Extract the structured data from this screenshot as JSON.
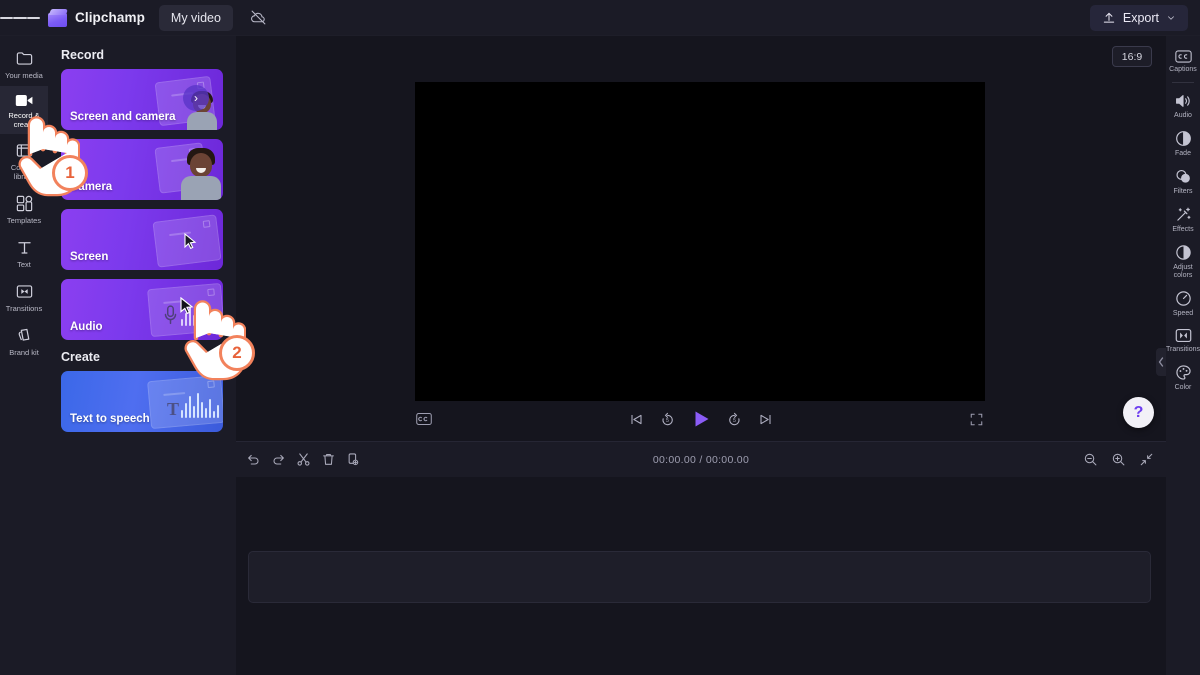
{
  "header": {
    "menu_icon": "hamburger-menu-icon",
    "brand": "Clipchamp",
    "project_name": "My video",
    "cloud_icon": "cloud-offline-icon",
    "export_label": "Export",
    "export_icon": "upload-icon",
    "export_caret": "chevron-down-icon"
  },
  "left_rail": {
    "items": [
      {
        "label": "Your media",
        "icon": "folder-icon",
        "active": false
      },
      {
        "label": "Record & create",
        "icon": "video-camera-icon",
        "active": true
      },
      {
        "label": "Content library",
        "icon": "library-icon",
        "active": false
      },
      {
        "label": "Templates",
        "icon": "templates-grid-icon",
        "active": false
      },
      {
        "label": "Text",
        "icon": "text-t-icon",
        "active": false
      },
      {
        "label": "Transitions",
        "icon": "transitions-icon",
        "active": false
      },
      {
        "label": "Brand kit",
        "icon": "brand-kit-icon",
        "active": false
      }
    ]
  },
  "panel": {
    "section_record": "Record",
    "section_create": "Create",
    "record_cards": [
      {
        "label": "Screen and camera",
        "art": "screen-and-camera-art",
        "color": "#7c3aed",
        "has_chevron": true
      },
      {
        "label": "Camera",
        "art": "camera-art",
        "color": "#7c3aed",
        "has_chevron": false
      },
      {
        "label": "Screen",
        "art": "screen-art",
        "color": "#7c3aed",
        "has_chevron": false
      },
      {
        "label": "Audio",
        "art": "audio-art",
        "color": "#7c3aed",
        "has_chevron": false
      }
    ],
    "create_cards": [
      {
        "label": "Text to speech",
        "art": "text-to-speech-art",
        "color": "#3b5bdb",
        "has_chevron": false
      }
    ]
  },
  "stage": {
    "aspect_ratio": "16:9",
    "player": {
      "captions_icon": "captions-toggle-icon",
      "skip_start_icon": "skip-to-start-icon",
      "back5_icon": "rewind-5s-icon",
      "play_icon": "play-icon",
      "fwd5_icon": "forward-5s-icon",
      "skip_end_icon": "skip-to-end-icon",
      "fullscreen_icon": "fullscreen-icon"
    },
    "help_label": "?",
    "collapse_icon": "chevron-left-icon"
  },
  "right_rail": {
    "items": [
      {
        "label": "Captions",
        "icon": "closed-captions-icon",
        "divider_after": true
      },
      {
        "label": "Audio",
        "icon": "speaker-icon",
        "divider_after": false
      },
      {
        "label": "Fade",
        "icon": "fade-icon",
        "divider_after": false
      },
      {
        "label": "Filters",
        "icon": "filters-icon",
        "divider_after": false
      },
      {
        "label": "Effects",
        "icon": "effects-wand-icon",
        "divider_after": false
      },
      {
        "label": "Adjust colors",
        "icon": "adjust-colors-icon",
        "divider_after": false
      },
      {
        "label": "Speed",
        "icon": "speed-gauge-icon",
        "divider_after": false
      },
      {
        "label": "Transitions",
        "icon": "transitions-icon",
        "divider_after": false
      },
      {
        "label": "Color",
        "icon": "color-palette-icon",
        "divider_after": false
      }
    ]
  },
  "timeline": {
    "tools": [
      {
        "name": "undo-button",
        "icon": "undo-icon"
      },
      {
        "name": "redo-button",
        "icon": "redo-icon"
      },
      {
        "name": "split-button",
        "icon": "scissors-icon"
      },
      {
        "name": "delete-button",
        "icon": "trash-icon"
      },
      {
        "name": "duplicate-button",
        "icon": "duplicate-icon"
      }
    ],
    "current_time": "00:00.00",
    "total_time": "00:00.00",
    "time_display": "00:00.00 / 00:00.00",
    "zoom_out_icon": "zoom-out-icon",
    "zoom_in_icon": "zoom-in-icon",
    "fit_icon": "fit-to-screen-icon"
  },
  "annotations": {
    "steps": [
      {
        "number": "1",
        "target": "record-and-create-rail-item"
      },
      {
        "number": "2",
        "target": "screen-record-card"
      }
    ],
    "badge_color": "#f2825c",
    "badge_text_color": "#e8623a"
  }
}
